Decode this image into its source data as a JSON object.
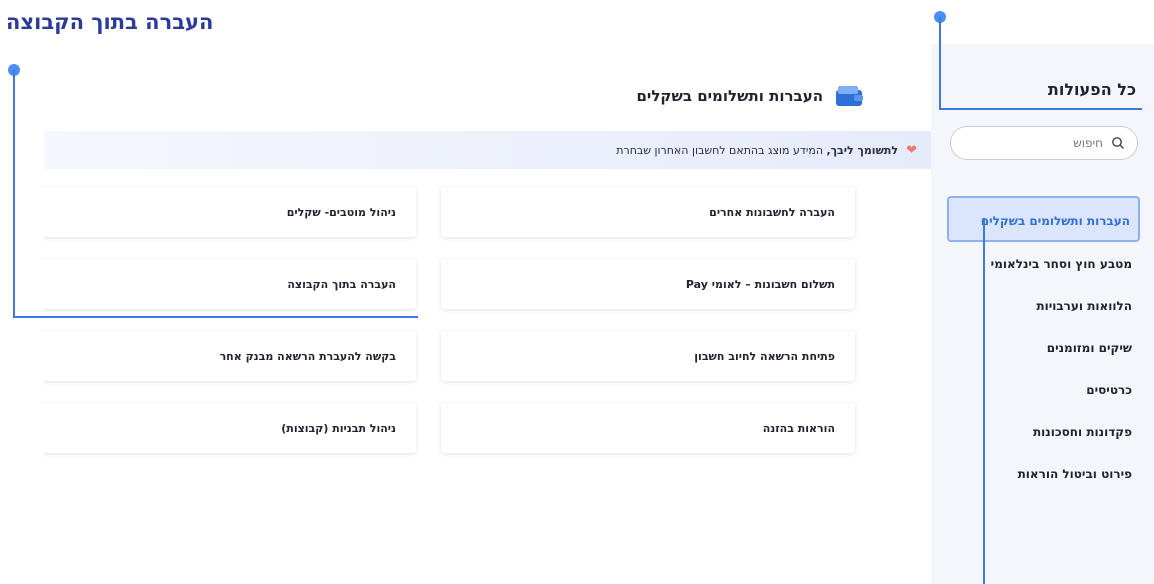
{
  "annotation_title": "העברה בתוך הקבוצה",
  "sidebar": {
    "title": "כל הפעולות",
    "search_placeholder": "חיפוש",
    "items": [
      {
        "label": "העברות ותשלומים בשקלים",
        "active": true
      },
      {
        "label": "מטבע חוץ וסחר בינלאומי"
      },
      {
        "label": "הלוואות וערבויות"
      },
      {
        "label": "שיקים ומזומנים"
      },
      {
        "label": "כרטיסים"
      },
      {
        "label": "פקדונות וחסכונות"
      },
      {
        "label": "פירוט וביטול הוראות"
      }
    ]
  },
  "main": {
    "title": "העברות ותשלומים בשקלים",
    "title_icon": "wallet-icon",
    "notice": {
      "icon": "heart-icon",
      "bold_text": "לתשומך ליבך,",
      "text": "המידע מוצג בהתאם לחשבון האחרון שבחרת"
    },
    "actions_right": [
      "העברה לחשבונות אחרים",
      "תשלום חשבונות – לאומי Pay",
      "פתיחת הרשאה לחיוב חשבון",
      "הוראות בהזנה"
    ],
    "actions_left": [
      "ניהול מוטבים- שקלים",
      "העברה בתוך הקבוצה",
      "בקשה להעברת הרשאה מבנק אחר",
      "ניהול תבניות (קבוצות)"
    ]
  },
  "colors": {
    "accent": "#2f6fd8",
    "annotation": "#3f77e4",
    "heading": "#2c3a9a",
    "sidebar_bg": "#f4f6fb"
  }
}
